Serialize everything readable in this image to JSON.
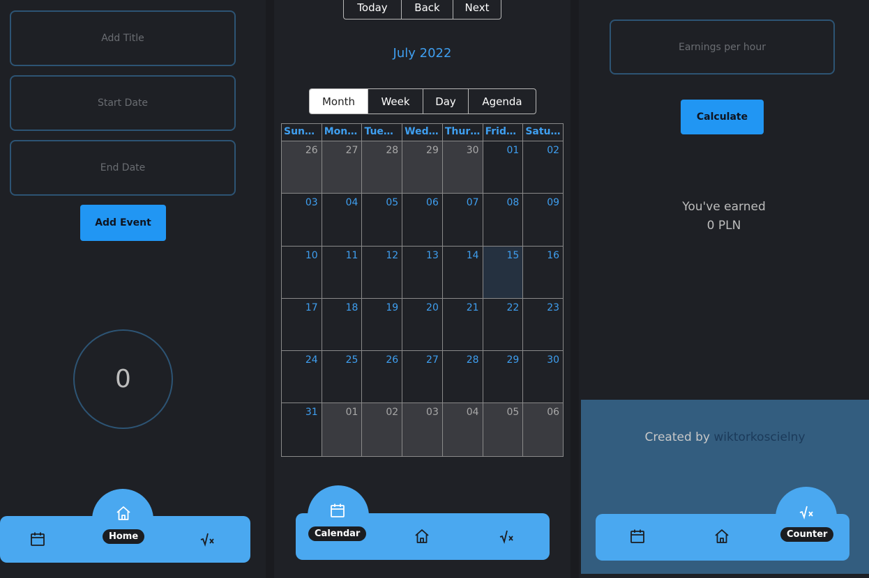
{
  "left_panel": {
    "title_placeholder": "Add Title",
    "start_placeholder": "Start Date",
    "end_placeholder": "End Date",
    "add_event_label": "Add Event",
    "counter_value": "0",
    "nav": {
      "home_label": "Home"
    }
  },
  "calendar_panel": {
    "toolbar": {
      "today": "Today",
      "back": "Back",
      "next": "Next"
    },
    "month_title": "July 2022",
    "views": [
      "Month",
      "Week",
      "Day",
      "Agenda"
    ],
    "active_view": "Month",
    "weekday_headers": [
      "Sun…",
      "Mon…",
      "Tue…",
      "Wed…",
      "Thur…",
      "Frid…",
      "Satu…"
    ],
    "weeks": [
      [
        "26",
        "27",
        "28",
        "29",
        "30",
        "01",
        "02"
      ],
      [
        "03",
        "04",
        "05",
        "06",
        "07",
        "08",
        "09"
      ],
      [
        "10",
        "11",
        "12",
        "13",
        "14",
        "15",
        "16"
      ],
      [
        "17",
        "18",
        "19",
        "20",
        "21",
        "22",
        "23"
      ],
      [
        "24",
        "25",
        "26",
        "27",
        "28",
        "29",
        "30"
      ],
      [
        "31",
        "01",
        "02",
        "03",
        "04",
        "05",
        "06"
      ]
    ],
    "nav": {
      "calendar_label": "Calendar"
    }
  },
  "earnings_panel": {
    "earnings_placeholder": "Earnings per hour",
    "calculate_label": "Calculate",
    "earned_line1": "You've earned",
    "earned_line2": "0 PLN",
    "credit_prefix": "Created by",
    "credit_author": "wiktorkoscielny",
    "nav": {
      "counter_label": "Counter"
    }
  },
  "colors": {
    "accent": "#2196f3",
    "nav_bar": "#4aa8f0",
    "footer": "#335d7f",
    "link": "#3f9ff0"
  }
}
